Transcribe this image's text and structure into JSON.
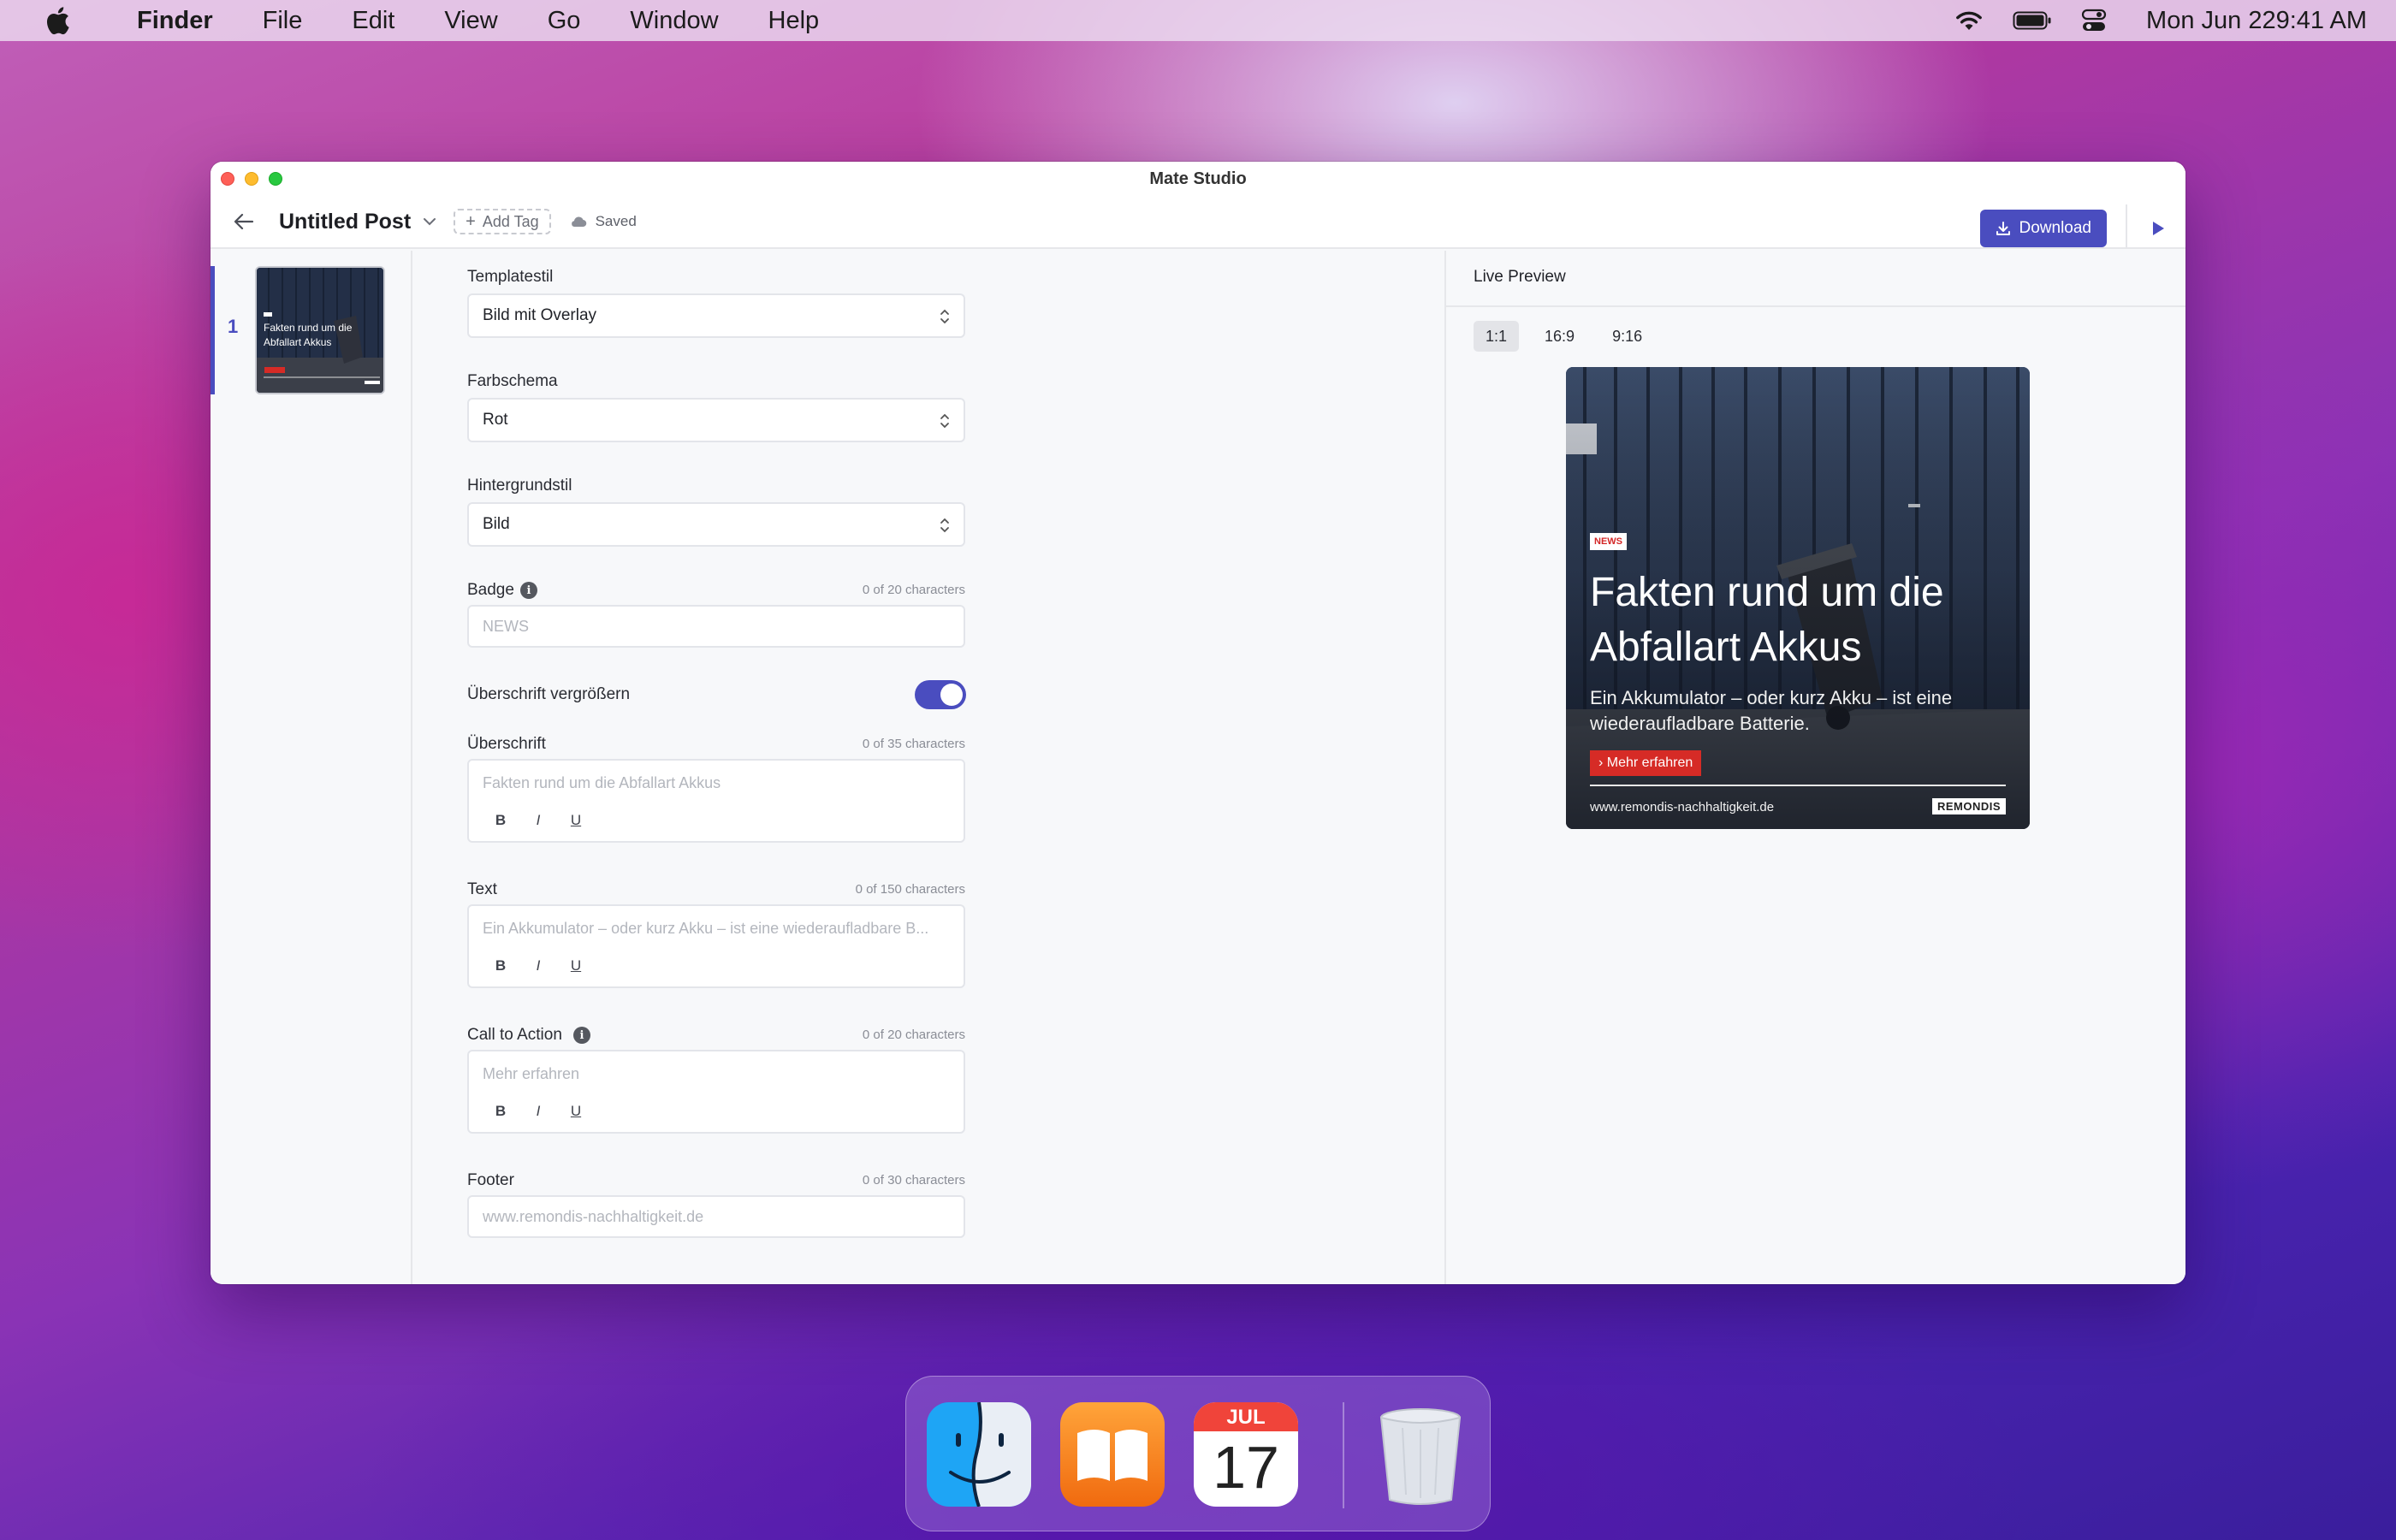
{
  "menubar": {
    "app_name": "Finder",
    "menus": [
      "File",
      "Edit",
      "View",
      "Go",
      "Window",
      "Help"
    ],
    "date": "Mon Jun 22",
    "time": "9:41 AM"
  },
  "window": {
    "title": "Mate Studio"
  },
  "toolbar": {
    "post_title": "Untitled Post",
    "add_tag_label": "Add Tag",
    "saved_label": "Saved",
    "download_label": "Download",
    "accent_color": "#4a4dbf"
  },
  "rail": {
    "slides": [
      {
        "number": "1",
        "headline": "Fakten rund um die Abfallart Akkus"
      }
    ]
  },
  "form": {
    "template_style": {
      "label": "Templatestil",
      "value": "Bild mit Overlay"
    },
    "color_scheme": {
      "label": "Farbschema",
      "value": "Rot"
    },
    "background_style": {
      "label": "Hintergrundstil",
      "value": "Bild"
    },
    "badge": {
      "label": "Badge",
      "counter": "0 of 20 characters",
      "placeholder": "NEWS"
    },
    "enlarge_headline": {
      "label": "Überschrift vergrößern",
      "enabled": true
    },
    "headline": {
      "label": "Überschrift",
      "counter": "0 of 35 characters",
      "placeholder": "Fakten rund um die Abfallart Akkus"
    },
    "text": {
      "label": "Text",
      "counter": "0 of 150 characters",
      "placeholder": "Ein Akkumulator – oder kurz Akku – ist eine wiederaufladbare B..."
    },
    "cta": {
      "label": "Call to Action",
      "counter": "0 of 20 characters",
      "placeholder": "Mehr erfahren"
    },
    "footer": {
      "label": "Footer",
      "counter": "0 of 30 characters",
      "placeholder": "www.remondis-nachhaltigkeit.de"
    },
    "format_buttons": [
      "B",
      "I",
      "U"
    ]
  },
  "preview": {
    "title": "Live Preview",
    "ratios": [
      "1:1",
      "16:9",
      "9:16"
    ],
    "active_ratio": "1:1",
    "ad": {
      "badge": "NEWS",
      "headline": "Fakten rund um die Abfallart Akkus",
      "text": "Ein Akkumulator – oder kurz Akku – ist eine wiederaufladbare Batterie.",
      "cta": "› Mehr erfahren",
      "footer": "www.remondis-nachhaltigkeit.de",
      "logo": "REMONDIS",
      "cta_color": "#d62b26"
    }
  },
  "dock": {
    "apps": [
      "Finder",
      "Books",
      "Calendar",
      "Trash"
    ],
    "calendar_month": "JUL",
    "calendar_day": "17"
  }
}
